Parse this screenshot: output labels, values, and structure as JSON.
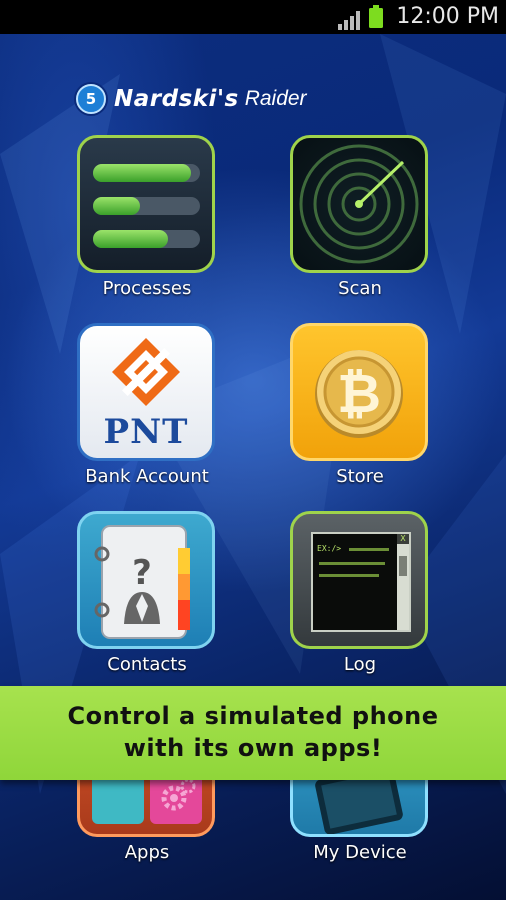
{
  "status_bar": {
    "time": "12:00 PM",
    "signal_icon": "signal-icon",
    "battery_icon": "battery-icon"
  },
  "brand": {
    "badge": "5",
    "name": "Nardski's",
    "subtitle": "Raider"
  },
  "apps": [
    {
      "label": "Processes",
      "icon": "processes-icon",
      "progress": [
        0.92,
        0.44,
        0.7
      ]
    },
    {
      "label": "Scan",
      "icon": "radar-icon"
    },
    {
      "label": "Bank Account",
      "icon": "bank-icon",
      "logo_text": "PNT"
    },
    {
      "label": "Store",
      "icon": "bitcoin-icon"
    },
    {
      "label": "Contacts",
      "icon": "contacts-book-icon"
    },
    {
      "label": "Log",
      "icon": "terminal-log-icon",
      "prompt": "EX:/>",
      "close": "X"
    },
    {
      "label": "Apps",
      "icon": "apps-grid-icon"
    },
    {
      "label": "My Device",
      "icon": "device-icon"
    }
  ],
  "banner": {
    "line1": "Control a simulated phone",
    "line2": "with its own apps!"
  },
  "colors": {
    "accent_green": "#9fd34b",
    "banner_green": "#a7e24e",
    "store_gold": "#ffc52d",
    "bank_blue": "#2f6fc4"
  }
}
